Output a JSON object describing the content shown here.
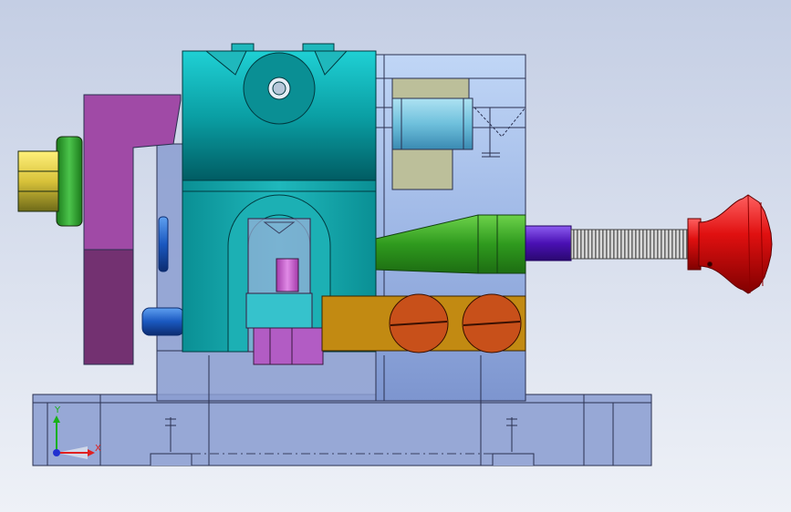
{
  "viewport": {
    "background_top": "#c4cee4",
    "background_bottom": "#eef1f7"
  },
  "triad": {
    "x_label": "X",
    "y_label": "Y",
    "x_color": "#e02020",
    "y_color": "#18b018",
    "z_color": "#2030d0"
  },
  "colors": {
    "base": "#97a8d6",
    "base_edge": "#2a3050",
    "housing": "#8a9cd0",
    "slide_top": "#0ea4a4",
    "slide_dark": "#00707a",
    "slide_body": "#15a3a6",
    "magenta_bracket": "#a04aa6",
    "magenta_dark": "#733171",
    "yellow_nut": "#e8d44a",
    "green_collar": "#2ea43a",
    "green_cone": "#3ea42e",
    "purple_shaft": "#5a16c0",
    "thread_silver": "#b8b8b8",
    "red_knob": "#d81010",
    "gold_block": "#c28a12",
    "orange_screw": "#c8501a",
    "blue_pin": "#1e5fc8",
    "olive_bushing": "#bcbf9a",
    "pink_post": "#c050c8"
  }
}
